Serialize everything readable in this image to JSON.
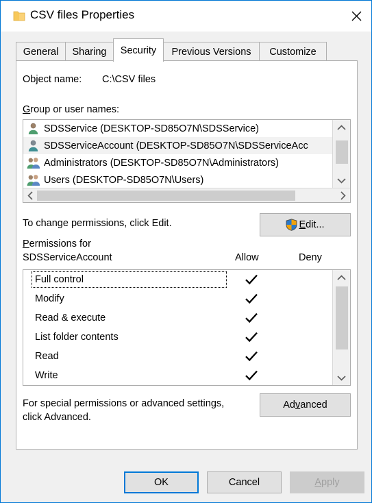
{
  "window": {
    "title": "CSV files Properties",
    "folder_icon": "folder-icon",
    "close_icon": "close-icon",
    "accent_color": "#0078d7",
    "face_color": "#f0f0f0"
  },
  "tabs": [
    {
      "label": "General",
      "active": false
    },
    {
      "label": "Sharing",
      "active": false
    },
    {
      "label": "Security",
      "active": true
    },
    {
      "label": "Previous Versions",
      "active": false
    },
    {
      "label": "Customize",
      "active": false
    }
  ],
  "security": {
    "object_name_label": "Object name:",
    "object_name_value": "C:\\CSV files",
    "group_label_accel": "G",
    "group_label_rest": "roup or user names:",
    "groups": [
      {
        "name": "SDSService (DESKTOP-SD85O7N\\SDSService)",
        "icon": "user-icon",
        "selected": false
      },
      {
        "name": "SDSServiceAccount (DESKTOP-SD85O7N\\SDSServiceAcc",
        "icon": "user-icon",
        "selected": true
      },
      {
        "name": "Administrators (DESKTOP-SD85O7N\\Administrators)",
        "icon": "group-icon",
        "selected": false
      },
      {
        "name": "Users (DESKTOP-SD85O7N\\Users)",
        "icon": "group-icon",
        "selected": false
      }
    ],
    "edit_hint": "To change permissions, click Edit.",
    "edit_button": {
      "accel": "E",
      "rest": "dit...",
      "shield_icon": "uac-shield-icon"
    },
    "permissions_for_line1_accel": "P",
    "permissions_for_line1_rest": "ermissions for",
    "permissions_for_line2": "SDSServiceAccount",
    "column_allow": "Allow",
    "column_deny": "Deny",
    "permissions": [
      {
        "name": "Full control",
        "allow": true,
        "deny": false,
        "focused": true
      },
      {
        "name": "Modify",
        "allow": true,
        "deny": false,
        "focused": false
      },
      {
        "name": "Read & execute",
        "allow": true,
        "deny": false,
        "focused": false
      },
      {
        "name": "List folder contents",
        "allow": true,
        "deny": false,
        "focused": false
      },
      {
        "name": "Read",
        "allow": true,
        "deny": false,
        "focused": false
      },
      {
        "name": "Write",
        "allow": true,
        "deny": false,
        "focused": false
      }
    ],
    "advanced_hint_line1": "For special permissions or advanced settings,",
    "advanced_hint_line2": "click Advanced.",
    "advanced_button": {
      "pre": "Ad",
      "accel": "v",
      "rest": "anced"
    }
  },
  "footer": {
    "ok": "OK",
    "cancel": "Cancel",
    "apply": {
      "accel": "A",
      "rest": "pply",
      "disabled": true
    }
  }
}
